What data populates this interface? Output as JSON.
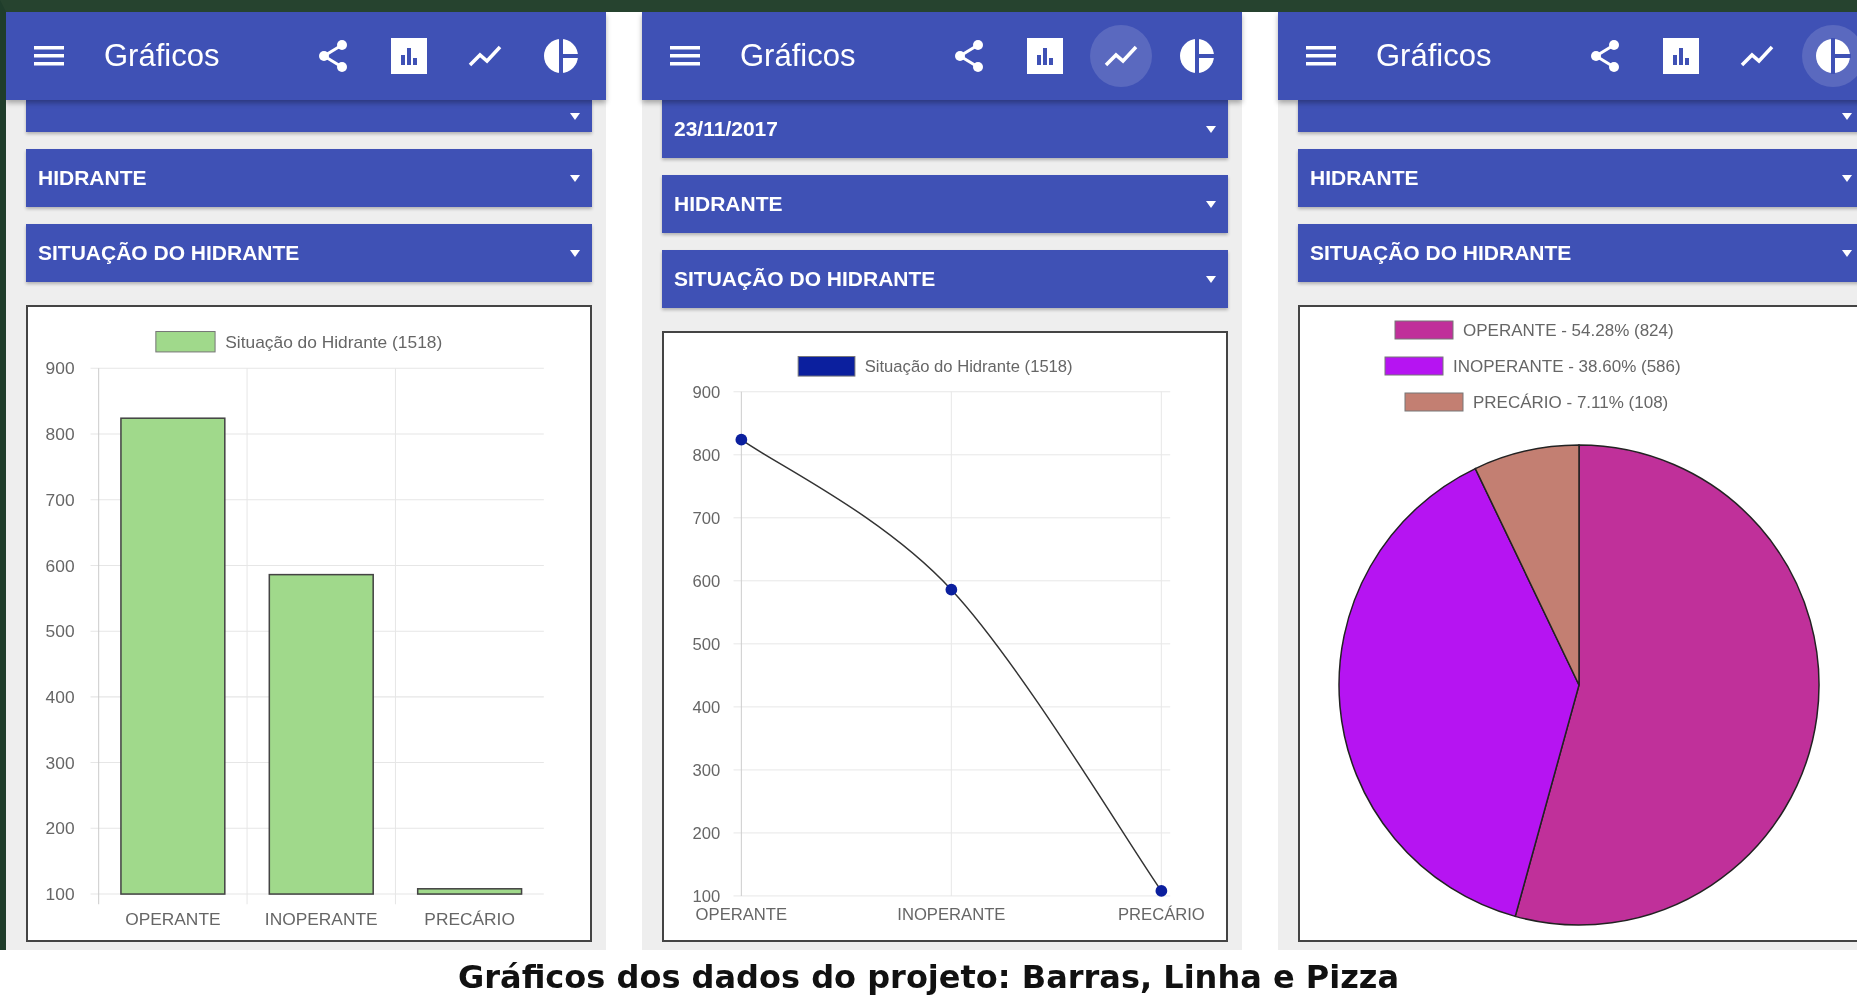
{
  "panels": [
    {
      "title": "Gráficos",
      "scrolled": true,
      "toolbar": [
        {
          "kind": "share",
          "selected": false
        },
        {
          "kind": "bar",
          "selected": false
        },
        {
          "kind": "line",
          "selected": false
        },
        {
          "kind": "pie",
          "selected": false
        }
      ],
      "dropdowns": [
        {
          "value": "HIDRANTE"
        },
        {
          "value": "SITUAÇÃO DO HIDRANTE"
        }
      ],
      "chart_data": {
        "type": "bar",
        "categories": [
          "OPERANTE",
          "INOPERANTE",
          "PRECÁRIO"
        ],
        "series": [
          {
            "name": "Situação do Hidrante (1518)",
            "color": "#a0d98b",
            "values": [
              824,
              586,
              108
            ]
          }
        ],
        "ylim": [
          100,
          900
        ],
        "yticks": [
          100,
          200,
          300,
          400,
          500,
          600,
          700,
          800,
          900
        ],
        "grid": true
      }
    },
    {
      "title": "Gráficos",
      "scrolled": false,
      "toolbar": [
        {
          "kind": "share",
          "selected": false
        },
        {
          "kind": "bar",
          "selected": false
        },
        {
          "kind": "line",
          "selected": true
        },
        {
          "kind": "pie",
          "selected": false
        }
      ],
      "dropdowns": [
        {
          "value": "23/11/2017"
        },
        {
          "value": "HIDRANTE"
        },
        {
          "value": "SITUAÇÃO DO HIDRANTE"
        }
      ],
      "chart_data": {
        "type": "line",
        "categories": [
          "OPERANTE",
          "INOPERANTE",
          "PRECÁRIO"
        ],
        "series": [
          {
            "name": "Situação do Hidrante (1518)",
            "color": "#0b1f9e",
            "marker": "circle",
            "values": [
              824,
              586,
              108
            ]
          }
        ],
        "ylim": [
          100,
          900
        ],
        "yticks": [
          100,
          200,
          300,
          400,
          500,
          600,
          700,
          800,
          900
        ],
        "grid": true
      }
    },
    {
      "title": "Gráficos",
      "scrolled": true,
      "toolbar": [
        {
          "kind": "share",
          "selected": false
        },
        {
          "kind": "bar",
          "selected": false
        },
        {
          "kind": "line",
          "selected": false
        },
        {
          "kind": "pie",
          "selected": true
        }
      ],
      "dropdowns": [
        {
          "value": "HIDRANTE"
        },
        {
          "value": "SITUAÇÃO DO HIDRANTE"
        }
      ],
      "legend": [
        {
          "label": "OPERANTE - 54.28% (824)",
          "color": "#c0309a"
        },
        {
          "label": "INOPERANTE - 38.60% (586)",
          "color": "#b614f2"
        },
        {
          "label": "PRECÁRIO - 7.11% (108)",
          "color": "#c37f72"
        }
      ],
      "chart_data": {
        "type": "pie",
        "values": [
          54.28,
          38.61,
          7.11
        ]
      }
    }
  ],
  "caption": "Gráficos dos dados do projeto: Barras, Linha e Pizza"
}
